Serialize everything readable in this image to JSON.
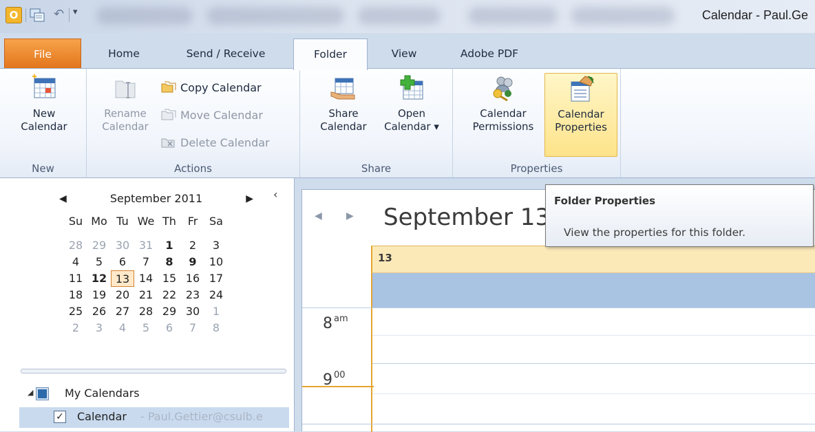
{
  "title_bar": {
    "window_title": "Calendar - Paul.Ge",
    "qat_app_letter": "O"
  },
  "tabs": [
    {
      "label": "File"
    },
    {
      "label": "Home"
    },
    {
      "label": "Send / Receive"
    },
    {
      "label": "Folder"
    },
    {
      "label": "View"
    },
    {
      "label": "Adobe PDF"
    }
  ],
  "ribbon": {
    "groups": {
      "new": {
        "label": "New",
        "new_calendar": [
          "New",
          "Calendar"
        ]
      },
      "actions": {
        "label": "Actions",
        "rename_calendar": [
          "Rename",
          "Calendar"
        ],
        "copy_calendar": "Copy Calendar",
        "move_calendar": "Move Calendar",
        "delete_calendar": "Delete Calendar"
      },
      "share": {
        "label": "Share",
        "share_calendar": [
          "Share",
          "Calendar"
        ],
        "open_calendar": [
          "Open",
          "Calendar ▾"
        ]
      },
      "properties": {
        "label": "Properties",
        "calendar_permissions": [
          "Calendar",
          "Permissions"
        ],
        "calendar_properties": [
          "Calendar",
          "Properties"
        ]
      }
    }
  },
  "tooltip": {
    "title": "Folder Properties",
    "description": "View the properties for this folder."
  },
  "date_navigator": {
    "month": "September 2011",
    "weekdays": [
      "Su",
      "Mo",
      "Tu",
      "We",
      "Th",
      "Fr",
      "Sa"
    ],
    "weeks": [
      [
        "28",
        "29",
        "30",
        "31",
        "1",
        "2",
        "3"
      ],
      [
        "4",
        "5",
        "6",
        "7",
        "8",
        "9",
        "10"
      ],
      [
        "11",
        "12",
        "13",
        "14",
        "15",
        "16",
        "17"
      ],
      [
        "18",
        "19",
        "20",
        "21",
        "22",
        "23",
        "24"
      ],
      [
        "25",
        "26",
        "27",
        "28",
        "29",
        "30",
        "1"
      ],
      [
        "2",
        "3",
        "4",
        "5",
        "6",
        "7",
        "8"
      ]
    ],
    "selected_day": "13"
  },
  "folder_list": {
    "group_label": "My Calendars",
    "calendar_label": "Calendar",
    "calendar_owner": "- Paul.Gettier@csulb.e"
  },
  "day_view": {
    "date_heading": "September 13,",
    "day_number": "13",
    "times": [
      {
        "hour": "8",
        "suffix": "am"
      },
      {
        "hour": "9",
        "suffix": "00"
      }
    ]
  },
  "colors": {
    "file_tab": "#e2741b",
    "selected_button": "#fde38a",
    "today_header": "#fbe9b8",
    "allday_band": "#a9c3e3",
    "accent_line": "#e4a530"
  }
}
